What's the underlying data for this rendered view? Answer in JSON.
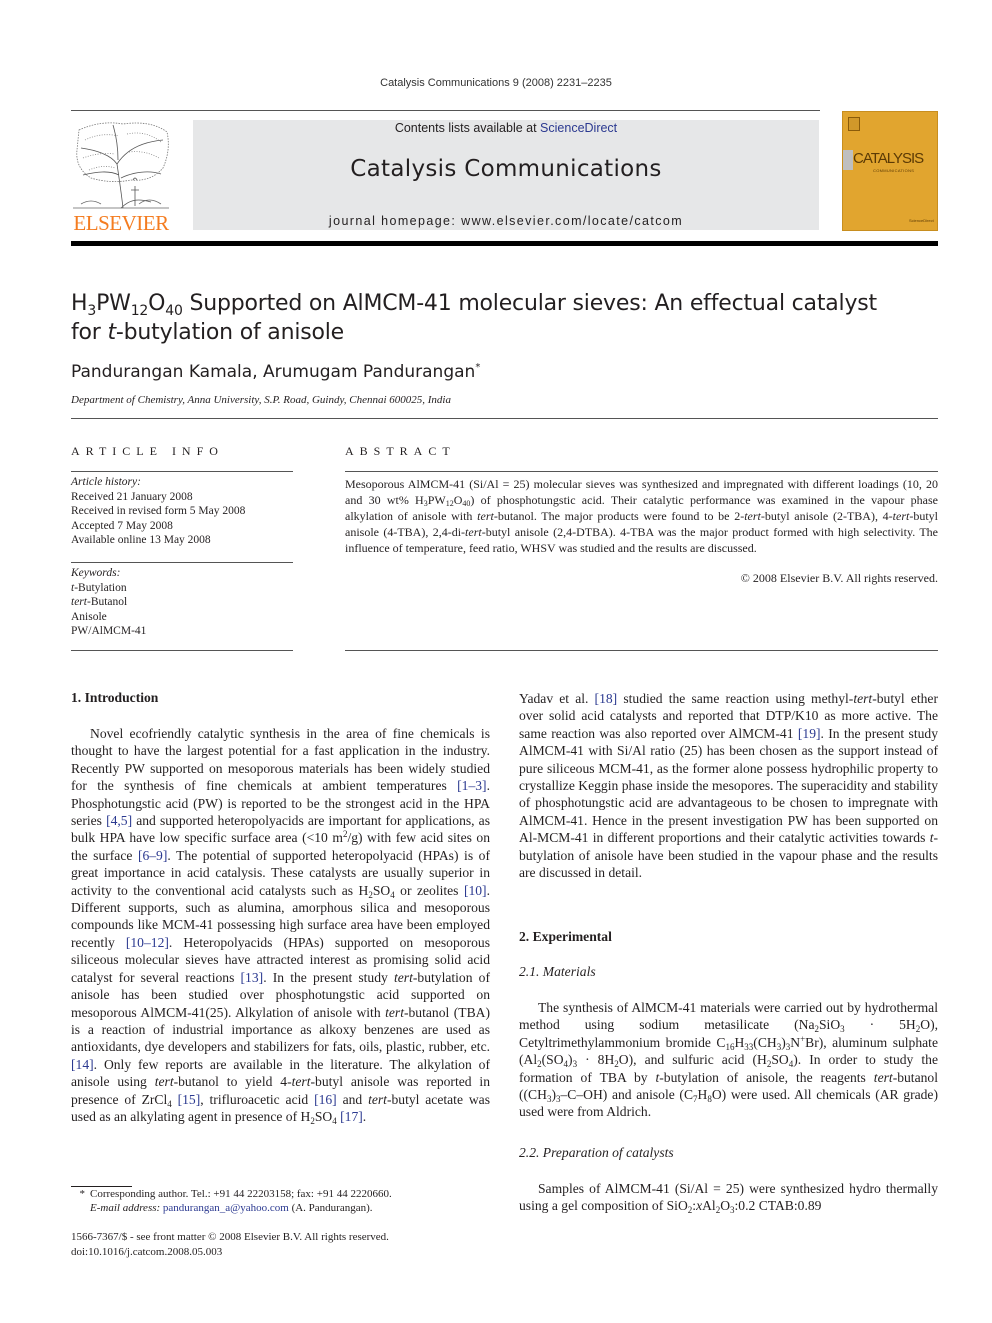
{
  "header": {
    "citation": "Catalysis Communications 9 (2008) 2231–2235",
    "contents_prefix": "Contents lists available at ",
    "contents_link": "ScienceDirect",
    "journal_title": "Catalysis Communications",
    "homepage": "journal homepage: www.elsevier.com/locate/catcom",
    "publisher_logo_text": "ELSEVIER",
    "cover_title": "CATALYSIS",
    "cover_subtitle": "COMMUNICATIONS",
    "cover_footer": "ScienceDirect",
    "colors": {
      "elsevier_orange": "#f47c20",
      "cover_gold": "#e1a52f",
      "link_blue": "#2b3990",
      "banner_gray": "#e6e7e8"
    }
  },
  "article": {
    "title_parts": {
      "h": "H",
      "s1": "3",
      "pw": "PW",
      "s2": "12",
      "o": "O",
      "s3": "40",
      "rest1": " Supported on AlMCM-41 molecular sieves: An effectual catalyst",
      "rest2_pre": "for ",
      "rest2_ital": "t",
      "rest2_post": "-butylation of anisole"
    },
    "authors": "Pandurangan Kamala, Arumugam Pandurangan",
    "author_mark": "*",
    "affiliation": "Department of Chemistry, Anna University, S.P. Road, Guindy, Chennai 600025, India"
  },
  "article_info": {
    "heading": "ARTICLE INFO",
    "history_label": "Article history:",
    "history": [
      "Received 21 January 2008",
      "Received in revised form 5 May 2008",
      "Accepted 7 May 2008",
      "Available online 13 May 2008"
    ],
    "keywords_label": "Keywords:",
    "keywords": [
      {
        "ital": "t",
        "rest": "-Butylation"
      },
      {
        "ital": "tert",
        "rest": "-Butanol"
      },
      {
        "ital": "",
        "rest": "Anisole"
      },
      {
        "ital": "",
        "rest": "PW/AlMCM-41"
      }
    ]
  },
  "abstract": {
    "heading": "ABSTRACT",
    "t1": "Mesoporous AlMCM-41 (Si/Al = 25) molecular sieves was synthesized and impregnated with different loadings (10, 20 and 30 wt% H",
    "s1": "3",
    "t2": "PW",
    "s2": "12",
    "t3": "O",
    "s3": "40",
    "t4": ") of phosphotungstic acid. Their catalytic performance was examined in the vapour phase alkylation of anisole with ",
    "i1": "tert",
    "t5": "-butanol. The major products were found to be 2-",
    "i2": "tert",
    "t6": "-butyl anisole (2-TBA), 4-",
    "i3": "tert",
    "t7": "-butyl anisole (4-TBA), 2,4-di-",
    "i4": "tert",
    "t8": "-butyl anisole (2,4-DTBA). 4-TBA was the major product formed with high selectivity. The influence of temperature, feed ratio, WHSV was studied and the results are discussed.",
    "copyright": "© 2008 Elsevier B.V. All rights reserved."
  },
  "introduction": {
    "heading": "1. Introduction",
    "p": [
      "Novel ecofriendly catalytic synthesis in the area of fine chemicals is thought to have the largest potential for a fast application in the industry. Recently PW supported on mesoporous materials has been widely studied for the synthesis of fine chemicals at ambient temperatures ",
      "[1–3]",
      ". Phosphotungstic acid (PW) is reported to be the strongest acid in the HPA series ",
      "[4,5]",
      " and supported heteropolyacids are important for applications, as bulk HPA have low specific surface area (<10 m",
      "2",
      "/g) with few acid sites on the surface ",
      "[6–9]",
      ". The potential of supported heteropolyacid (HPAs) is of great importance in acid catalysis. These catalysts are usually superior in activity to the conventional acid catalysts such as H",
      "2",
      "SO",
      "4",
      " or zeolites ",
      "[10]",
      ". Different supports, such as alumina, amorphous silica and mesoporous compounds like MCM-41 possessing high surface area have been employed recently ",
      "[10–12]",
      ". Heteropolyacids (HPAs) supported on mesoporous siliceous molecular sieves have attracted interest as promising solid acid catalyst for several reactions ",
      "[13]",
      ". In the present study ",
      "tert",
      "-butylation of anisole has been studied over phosphotungstic acid supported on mesoporous AlMCM-41(25). Alkylation of anisole with ",
      "tert",
      "-butanol (TBA) is a reaction of industrial importance as alkoxy benzenes are used as antioxidants, dye developers and stabilizers for fats, oils, plastic, rubber, etc. ",
      "[14]",
      ". Only few reports are available in the literature. The alkylation of anisole using ",
      "tert",
      "-butanol to yield 4-",
      "tert",
      "-butyl anisole was reported in presence of ZrCl",
      "4",
      " ",
      "[15]",
      ", trifluroacetic acid ",
      "[16]",
      " and ",
      "tert",
      "-butyl acetate was used as an alkylating agent in presence of H",
      "2",
      "SO",
      "4",
      " ",
      "[17]",
      "."
    ],
    "continued": [
      "Yadav et al. ",
      "[18]",
      " studied the same reaction using methyl-",
      "tert",
      "-butyl ether over solid acid catalysts and reported that DTP/K10 as more active. The same reaction was also reported over AlMCM-41 ",
      "[19]",
      ". In the present study AlMCM-41 with Si/Al ratio (25) has been chosen as the support instead of pure siliceous MCM-41, as the former alone possess hydrophilic property to crystallize Keggin phase inside the mesopores. The superacidity and stability of phosphotungstic acid are advantageous to be chosen to impregnate with AlMCM-41. Hence in the present investigation PW has been supported on Al-MCM-41 in different proportions and their catalytic activities towards ",
      "t",
      "-butylation of anisole have been studied in the vapour phase and the results are discussed in detail."
    ]
  },
  "experimental": {
    "heading": "2. Experimental",
    "materials_heading": "2.1. Materials",
    "materials": [
      "The synthesis of AlMCM-41 materials were carried out by hydrothermal method using sodium metasilicate (Na",
      "2",
      "SiO",
      "3",
      " · 5H",
      "2",
      "O), Cetyltrimethylammonium bromide C",
      "16",
      "H",
      "33",
      "(CH",
      "3",
      ")",
      "3",
      "N",
      "+",
      "Br), aluminum sulphate (Al",
      "2",
      "(SO",
      "4",
      ")",
      "3",
      " · 8H",
      "2",
      "O), and sulfuric acid (H",
      "2",
      "SO",
      "4",
      "). In order to study the formation of TBA by ",
      "t",
      "-butylation of anisole, the reagents ",
      "tert",
      "-butanol ((CH",
      "3",
      ")",
      "3",
      "–C–OH) and anisole (C",
      "7",
      "H",
      "8",
      "O) were used. All chemicals (AR grade) used were from Aldrich."
    ],
    "prep_heading": "2.2. Preparation of catalysts",
    "prep": [
      "Samples of AlMCM-41 (Si/Al = 25) were synthesized hydro thermally using a gel composition of SiO",
      "2",
      ":",
      "x",
      "Al",
      "2",
      "O",
      "3",
      ":0.2 CTAB:0.89"
    ]
  },
  "footnote": {
    "mark": "*",
    "line1": "Corresponding author. Tel.: +91 44 22203158; fax: +91 44 2220660.",
    "email_label": "E-mail address:",
    "email": "pandurangan_a@yahoo.com",
    "email_suffix": " (A. Pandurangan)."
  },
  "front_matter": {
    "issn": "1566-7367/$ - see front matter © 2008 Elsevier B.V. All rights reserved.",
    "doi": "doi:10.1016/j.catcom.2008.05.003"
  }
}
